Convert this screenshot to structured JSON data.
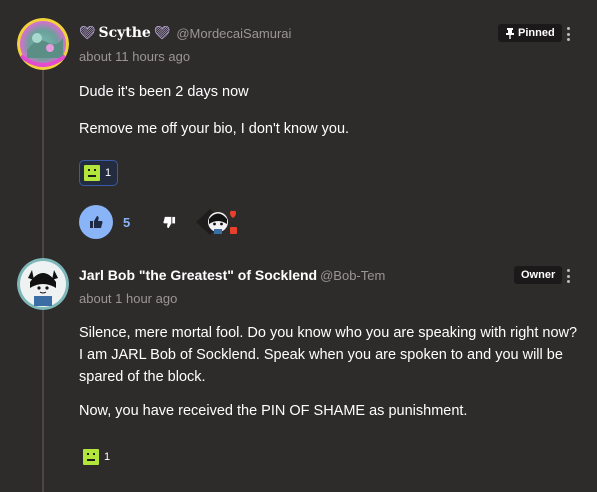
{
  "comments": [
    {
      "display_name": "Scythe",
      "handle": "@MordecaiSamurai",
      "timestamp": "about 11 hours ago",
      "badge": "Pinned",
      "paragraphs": [
        "Dude it's been 2 days now",
        "Remove me off your bio, I don't know you."
      ],
      "reaction_count": "1",
      "like_count": "5",
      "icons": {
        "avatar": "colorful-avatar",
        "badge": "pin-icon",
        "like": "thumbs-up-icon",
        "dislike": "thumbs-down-icon",
        "reaction": "pixel-face-emoji",
        "creator_heart": "creator-heart-icon",
        "menu": "more-vertical-icon"
      }
    },
    {
      "display_name": "Jarl Bob \"the Greatest\" of Socklend",
      "handle": "@Bob-Tem",
      "timestamp": "about 1 hour ago",
      "badge": "Owner",
      "paragraphs": [
        "Silence, mere mortal fool. Do you know who you are speaking with right now? I am JARL Bob of Socklend. Speak when you are spoken to and you will be spared of the block.",
        "Now, you have received the PIN OF SHAME as punishment."
      ],
      "reaction_count": "1",
      "icons": {
        "avatar": "cartoon-avatar",
        "reaction": "pixel-face-emoji",
        "menu": "more-vertical-icon"
      }
    }
  ],
  "colors": {
    "background": "#2e2b2b",
    "accent": "#8ab4f8",
    "muted_text": "#9a9696",
    "badge_bg": "#1b1919",
    "reaction_border": "#3a5aa8",
    "emoji_green": "#b3e63a",
    "heart_red": "#e8402a"
  }
}
